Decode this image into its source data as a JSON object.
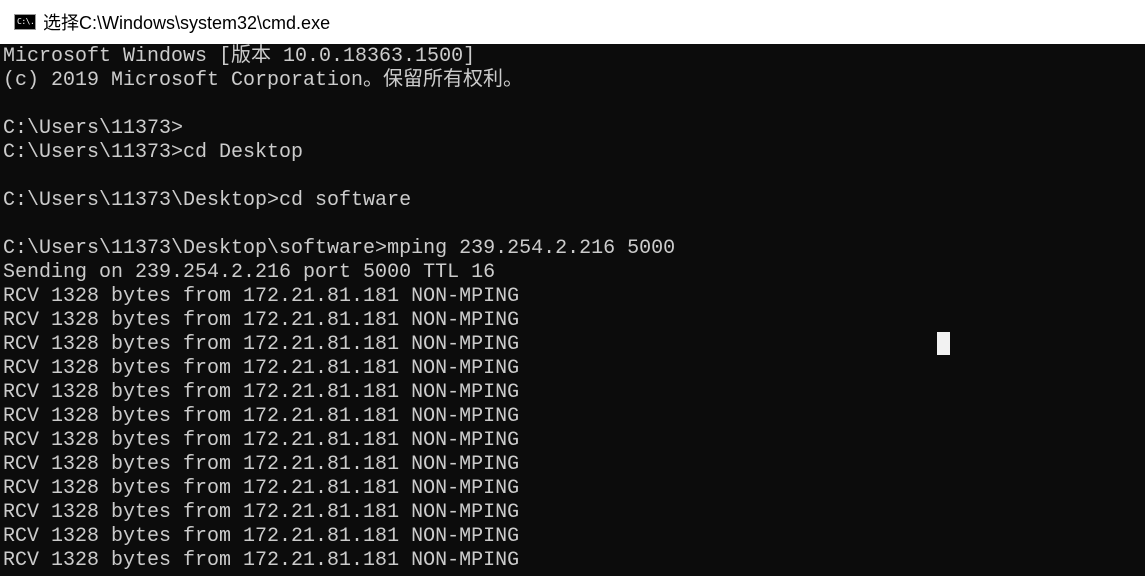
{
  "window": {
    "title": "选择C:\\Windows\\system32\\cmd.exe",
    "icon": "cmd-console-icon",
    "icon_glyph": "C:\\."
  },
  "console": {
    "background": "#0c0c0c",
    "text_color": "#cccccc",
    "lines": [
      "Microsoft Windows [版本 10.0.18363.1500]",
      "(c) 2019 Microsoft Corporation。保留所有权利。",
      "",
      "C:\\Users\\11373>",
      "C:\\Users\\11373>cd Desktop",
      "",
      "C:\\Users\\11373\\Desktop>cd software",
      "",
      "C:\\Users\\11373\\Desktop\\software>mping 239.254.2.216 5000",
      "Sending on 239.254.2.216 port 5000 TTL 16",
      "RCV 1328 bytes from 172.21.81.181 NON-MPING",
      "RCV 1328 bytes from 172.21.81.181 NON-MPING",
      "RCV 1328 bytes from 172.21.81.181 NON-MPING",
      "RCV 1328 bytes from 172.21.81.181 NON-MPING",
      "RCV 1328 bytes from 172.21.81.181 NON-MPING",
      "RCV 1328 bytes from 172.21.81.181 NON-MPING",
      "RCV 1328 bytes from 172.21.81.181 NON-MPING",
      "RCV 1328 bytes from 172.21.81.181 NON-MPING",
      "RCV 1328 bytes from 172.21.81.181 NON-MPING",
      "RCV 1328 bytes from 172.21.81.181 NON-MPING",
      "RCV 1328 bytes from 172.21.81.181 NON-MPING",
      "RCV 1328 bytes from 172.21.81.181 NON-MPING"
    ]
  }
}
